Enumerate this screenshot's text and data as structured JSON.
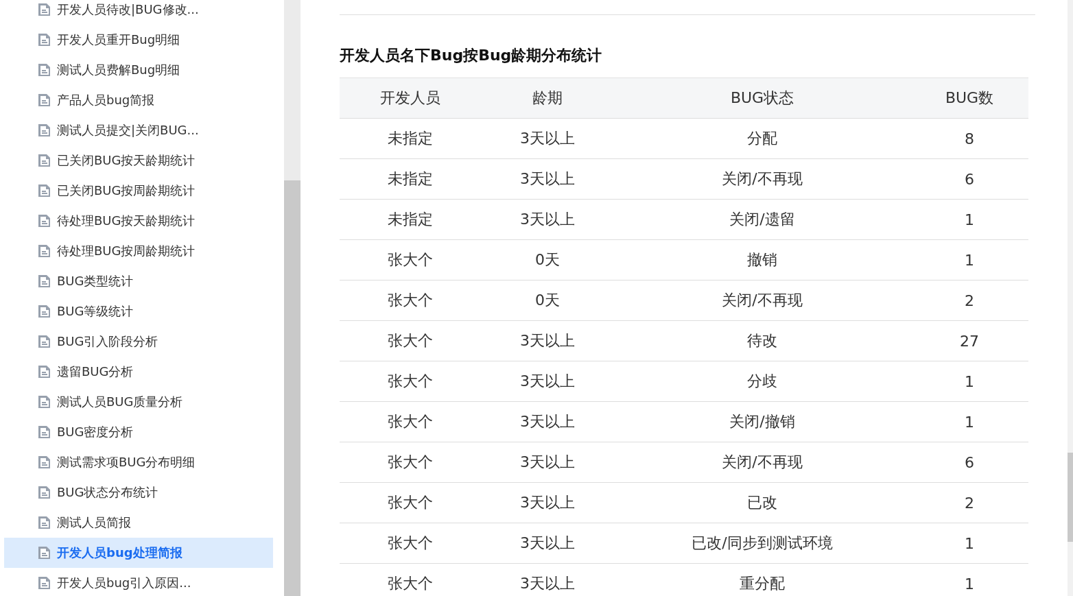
{
  "sidebar": {
    "items": [
      {
        "label": "开发人员待改|BUG修改...",
        "selected": false
      },
      {
        "label": "开发人员重开Bug明细",
        "selected": false
      },
      {
        "label": "测试人员费解Bug明细",
        "selected": false
      },
      {
        "label": "产品人员bug简报",
        "selected": false
      },
      {
        "label": "测试人员提交|关闭BUG...",
        "selected": false
      },
      {
        "label": "已关闭BUG按天龄期统计",
        "selected": false
      },
      {
        "label": "已关闭BUG按周龄期统计",
        "selected": false
      },
      {
        "label": "待处理BUG按天龄期统计",
        "selected": false
      },
      {
        "label": "待处理BUG按周龄期统计",
        "selected": false
      },
      {
        "label": "BUG类型统计",
        "selected": false
      },
      {
        "label": "BUG等级统计",
        "selected": false
      },
      {
        "label": "BUG引入阶段分析",
        "selected": false
      },
      {
        "label": "遗留BUG分析",
        "selected": false
      },
      {
        "label": "测试人员BUG质量分析",
        "selected": false
      },
      {
        "label": "BUG密度分析",
        "selected": false
      },
      {
        "label": "测试需求项BUG分布明细",
        "selected": false
      },
      {
        "label": "BUG状态分布统计",
        "selected": false
      },
      {
        "label": "测试人员简报",
        "selected": false
      },
      {
        "label": "开发人员bug处理简报",
        "selected": true
      },
      {
        "label": "开发人员bug引入原因...",
        "selected": false
      }
    ]
  },
  "section": {
    "title": "开发人员名下Bug按Bug龄期分布统计",
    "table": {
      "columns": [
        "开发人员",
        "龄期",
        "BUG状态",
        "BUG数"
      ],
      "rows": [
        [
          "未指定",
          "3天以上",
          "分配",
          "8"
        ],
        [
          "未指定",
          "3天以上",
          "关闭/不再现",
          "6"
        ],
        [
          "未指定",
          "3天以上",
          "关闭/遗留",
          "1"
        ],
        [
          "张大个",
          "0天",
          "撤销",
          "1"
        ],
        [
          "张大个",
          "0天",
          "关闭/不再现",
          "2"
        ],
        [
          "张大个",
          "3天以上",
          "待改",
          "27"
        ],
        [
          "张大个",
          "3天以上",
          "分歧",
          "1"
        ],
        [
          "张大个",
          "3天以上",
          "关闭/撤销",
          "1"
        ],
        [
          "张大个",
          "3天以上",
          "关闭/不再现",
          "6"
        ],
        [
          "张大个",
          "3天以上",
          "已改",
          "2"
        ],
        [
          "张大个",
          "3天以上",
          "已改/同步到测试环境",
          "1"
        ],
        [
          "张大个",
          "3天以上",
          "重分配",
          "1"
        ]
      ]
    }
  }
}
